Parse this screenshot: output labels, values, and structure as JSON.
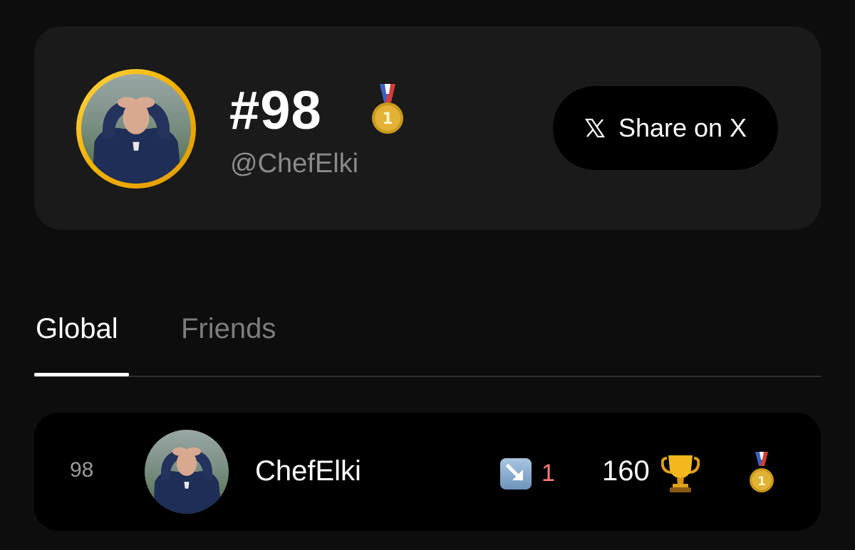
{
  "profile": {
    "rank_label": "#98",
    "handle": "@ChefElki",
    "badge_icon": "gold-medal-icon",
    "share_button": {
      "label": "Share on X",
      "icon": "x-logo-icon"
    }
  },
  "tabs": [
    {
      "label": "Global",
      "active": true
    },
    {
      "label": "Friends",
      "active": false
    }
  ],
  "leaderboard": {
    "rows": [
      {
        "rank": "98",
        "name": "ChefElki",
        "trend_icon": "arrow-down-right-icon",
        "trend_value": "1",
        "score": "160",
        "score_icon": "trophy-icon",
        "medal_icon": "gold-medal-icon"
      }
    ]
  },
  "colors": {
    "background": "#0d0d0d",
    "card": "#1a1a1a",
    "avatar_ring": "#f3b300",
    "trend_down": "#ff7a7a",
    "muted_text": "#8a8a8a"
  }
}
